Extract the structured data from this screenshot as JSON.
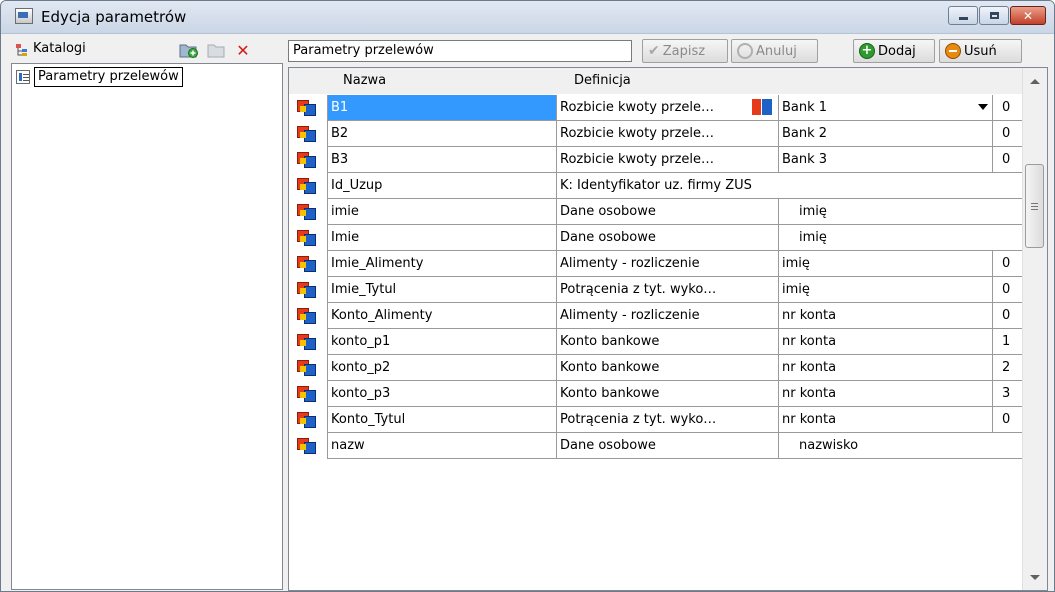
{
  "window": {
    "title": "Edycja parametrów"
  },
  "left": {
    "catalogs_label": "Katalogi",
    "tree": [
      {
        "label": "Parametry przelewów"
      }
    ]
  },
  "toolbar": {
    "name_value": "Parametry przelewów",
    "save_label": "Zapisz",
    "cancel_label": "Anuluj",
    "add_label": "Dodaj",
    "delete_label": "Usuń"
  },
  "grid": {
    "columns": [
      "Nazwa",
      "Definicja"
    ],
    "rows": [
      {
        "name": "B1",
        "definition": "Rozbicie kwoty przele…",
        "value": "Bank 1",
        "num": "0",
        "selected": true
      },
      {
        "name": "B2",
        "definition": "Rozbicie kwoty przele…",
        "value": "Bank 2",
        "num": "0"
      },
      {
        "name": "B3",
        "definition": "Rozbicie kwoty przele…",
        "value": "Bank 3",
        "num": "0"
      },
      {
        "name": "Id_Uzup",
        "definition": "K: Identyfikator uz. firmy ZUS",
        "value": "",
        "num": ""
      },
      {
        "name": "imie",
        "definition": "Dane osobowe",
        "value": "imię",
        "num": ""
      },
      {
        "name": "Imie",
        "definition": "Dane osobowe",
        "value": "imię",
        "num": ""
      },
      {
        "name": "Imie_Alimenty",
        "definition": "Alimenty - rozliczenie",
        "value": "imię",
        "num": "0"
      },
      {
        "name": "Imie_Tytul",
        "definition": "Potrącenia z tyt. wyko…",
        "value": "imię",
        "num": "0"
      },
      {
        "name": "Konto_Alimenty",
        "definition": "Alimenty - rozliczenie",
        "value": "nr konta",
        "num": "0"
      },
      {
        "name": "konto_p1",
        "definition": "Konto bankowe",
        "value": "nr konta",
        "num": "1"
      },
      {
        "name": "konto_p2",
        "definition": "Konto bankowe",
        "value": "nr konta",
        "num": "2"
      },
      {
        "name": "konto_p3",
        "definition": "Konto bankowe",
        "value": "nr konta",
        "num": "3"
      },
      {
        "name": "Konto_Tytul",
        "definition": "Potrącenia z tyt. wyko…",
        "value": "nr konta",
        "num": "0"
      },
      {
        "name": "nazw",
        "definition": "Dane osobowe",
        "value": "nazwisko",
        "num": ""
      }
    ]
  },
  "icons": {
    "window": "app-window-icon",
    "catalogs": "catalog-tree-icon",
    "new_folder": "new-folder-icon",
    "folder_disabled": "folder-icon",
    "delete_x": "delete-icon",
    "param": "parameter-icon"
  },
  "colors": {
    "selection": "#3399ff",
    "close_button": "#c3402a",
    "add_green": "#2e9b2e",
    "delete_orange": "#e88a10"
  }
}
